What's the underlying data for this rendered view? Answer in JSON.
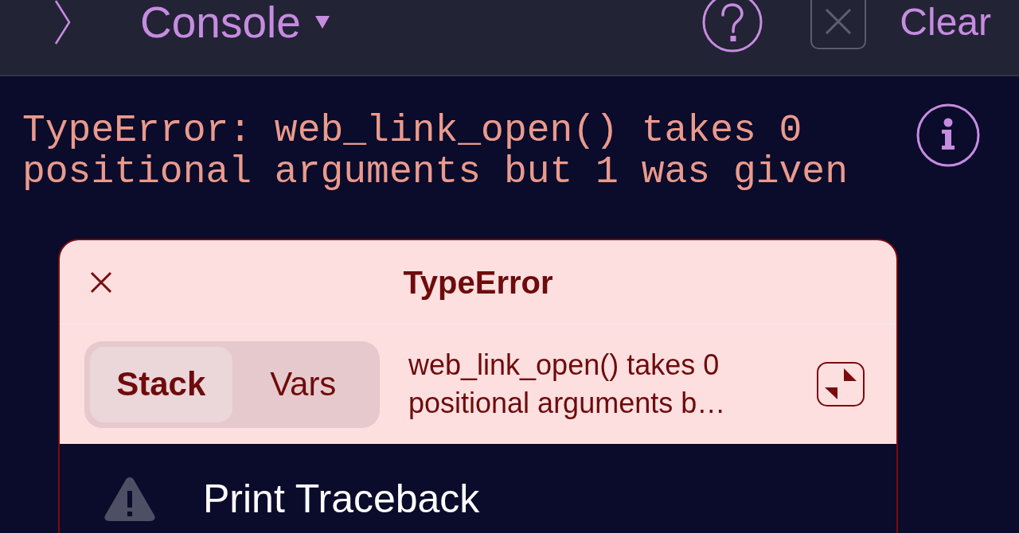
{
  "toolbar": {
    "title": "Console",
    "close_button": {
      "disabled": true
    },
    "clear_button": {
      "label": "Clear"
    }
  },
  "console": {
    "message": "TypeError: web_link_open() takes 0 positional arguments but 1 was given"
  },
  "error_card": {
    "title": "TypeError",
    "tabs": [
      {
        "label": "Stack",
        "selected": true
      },
      {
        "label": "Vars",
        "selected": false
      }
    ],
    "summary": "web_link_open() takes 0 positional arguments b…",
    "actions": [
      {
        "label": "Print Traceback"
      }
    ]
  }
}
